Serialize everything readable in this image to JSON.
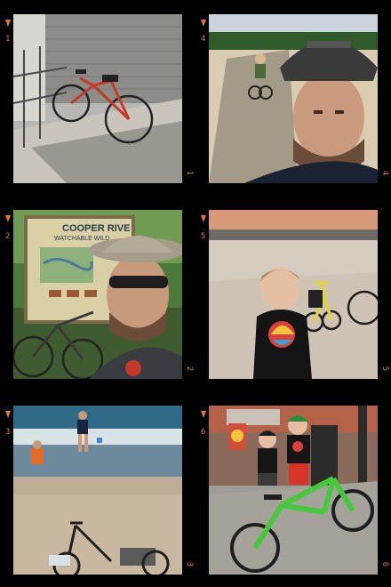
{
  "contact_sheet": {
    "frames": [
      {
        "number_top": "1",
        "number_bottom": "1",
        "subject": "bike-leaning-on-railing"
      },
      {
        "number_top": "4",
        "number_bottom": "4",
        "subject": "selfie-with-helmet"
      },
      {
        "number_top": "2",
        "number_bottom": "2",
        "subject": "selfie-by-trail-sign",
        "sign_line1": "COOPER RIVE",
        "sign_line2": "WATCHABLE WILD"
      },
      {
        "number_top": "5",
        "number_bottom": "5",
        "subject": "child-on-beach-with-bikes"
      },
      {
        "number_top": "3",
        "number_bottom": "3",
        "subject": "children-in-surf"
      },
      {
        "number_top": "6",
        "number_bottom": "6",
        "subject": "boys-with-green-bike"
      }
    ],
    "accent_color": "#e07a2a"
  }
}
